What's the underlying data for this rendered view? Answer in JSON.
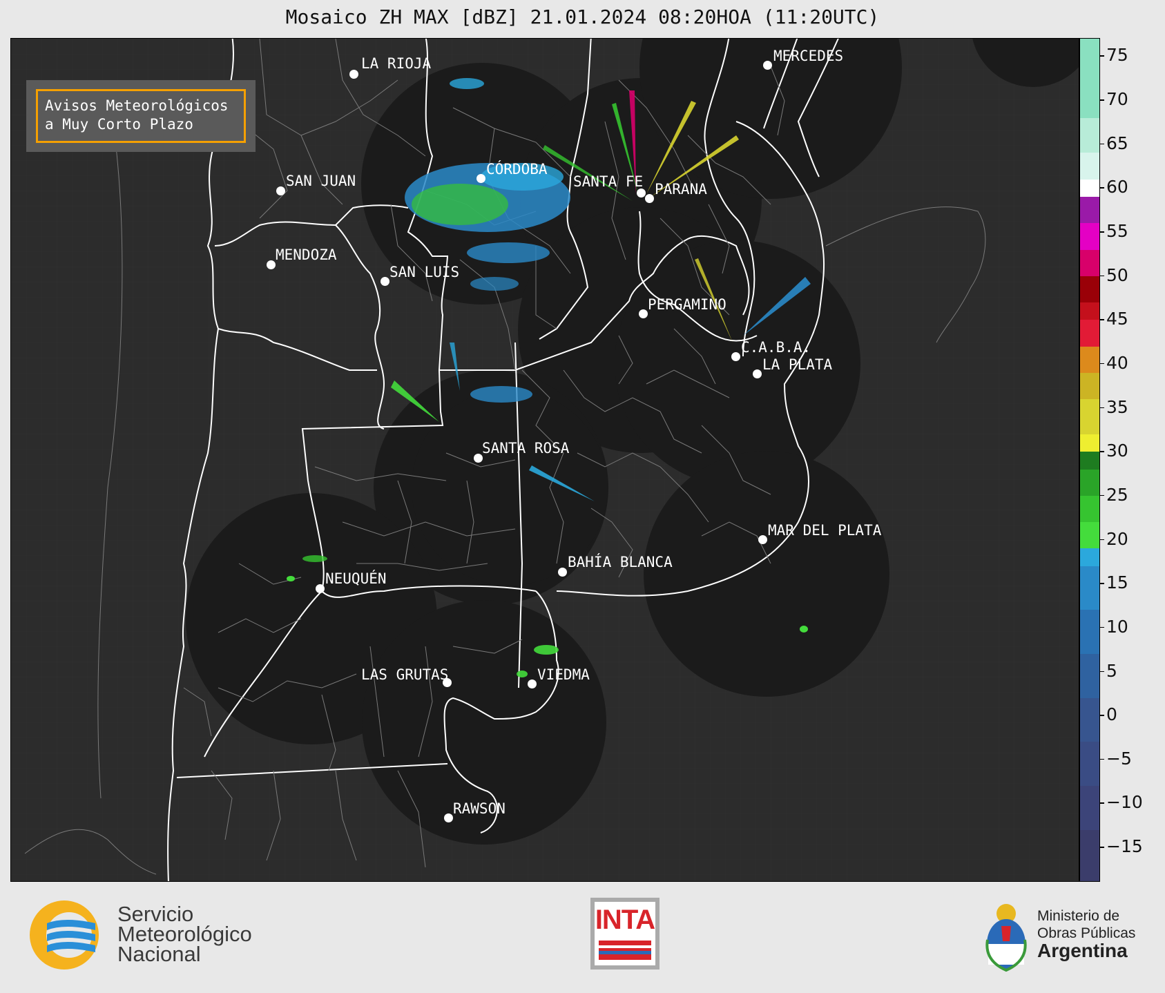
{
  "title": "Mosaico ZH MAX [dBZ] 21.01.2024 08:20HOA (11:20UTC)",
  "avisos": {
    "line1": "Avisos Meteorológicos",
    "line2": "a Muy Corto Plazo"
  },
  "colors": {
    "map_bg": "#2c2c2c",
    "radar_coverage": "#1b1b1b",
    "boundary": "#ffffff",
    "avisos_border": "#f5a000"
  },
  "cities": [
    {
      "name": "LA RIOJA"
    },
    {
      "name": "SAN JUAN"
    },
    {
      "name": "CÓRDOBA"
    },
    {
      "name": "SANTA FE"
    },
    {
      "name": "PARANA"
    },
    {
      "name": "MERCEDES"
    },
    {
      "name": "MENDOZA"
    },
    {
      "name": "SAN LUIS"
    },
    {
      "name": "PERGAMINO"
    },
    {
      "name": "C.A.B.A."
    },
    {
      "name": "LA PLATA"
    },
    {
      "name": "SANTA ROSA"
    },
    {
      "name": "MAR DEL PLATA"
    },
    {
      "name": "BAHÍA BLANCA"
    },
    {
      "name": "NEUQUÉN"
    },
    {
      "name": "LAS GRUTAS"
    },
    {
      "name": "VIEDMA"
    },
    {
      "name": "RAWSON"
    }
  ],
  "colorbar": {
    "unit": "dBZ",
    "min": -19,
    "max": 77,
    "ticks": [
      75,
      70,
      65,
      60,
      55,
      50,
      45,
      40,
      35,
      30,
      25,
      20,
      15,
      10,
      5,
      0,
      -5,
      -10,
      -15
    ],
    "tick_labels": [
      "75",
      "70",
      "65",
      "60",
      "55",
      "50",
      "45",
      "40",
      "35",
      "30",
      "25",
      "20",
      "15",
      "10",
      "5",
      "0",
      "−5",
      "−10",
      "−15"
    ],
    "segments": [
      {
        "from": -19,
        "to": -13,
        "color": "#3b3d6b"
      },
      {
        "from": -13,
        "to": -8,
        "color": "#3c4479"
      },
      {
        "from": -8,
        "to": -3,
        "color": "#3a4c84"
      },
      {
        "from": -3,
        "to": 2,
        "color": "#37558f"
      },
      {
        "from": 2,
        "to": 7,
        "color": "#2f62a0"
      },
      {
        "from": 7,
        "to": 12,
        "color": "#2a72b3"
      },
      {
        "from": 12,
        "to": 17,
        "color": "#2a8ac8"
      },
      {
        "from": 17,
        "to": 19,
        "color": "#2ba8dc"
      },
      {
        "from": 19,
        "to": 22,
        "color": "#44dc3c"
      },
      {
        "from": 22,
        "to": 25,
        "color": "#36c430"
      },
      {
        "from": 25,
        "to": 28,
        "color": "#2aa428"
      },
      {
        "from": 28,
        "to": 30,
        "color": "#1e7c20"
      },
      {
        "from": 30,
        "to": 32,
        "color": "#eeee30"
      },
      {
        "from": 32,
        "to": 36,
        "color": "#d8d430"
      },
      {
        "from": 36,
        "to": 39,
        "color": "#ccb424"
      },
      {
        "from": 39,
        "to": 42,
        "color": "#dc8a1c"
      },
      {
        "from": 42,
        "to": 45,
        "color": "#e21b36"
      },
      {
        "from": 45,
        "to": 47,
        "color": "#c4101c"
      },
      {
        "from": 47,
        "to": 50,
        "color": "#9a0008"
      },
      {
        "from": 50,
        "to": 53,
        "color": "#d8006a"
      },
      {
        "from": 53,
        "to": 56,
        "color": "#e400c4"
      },
      {
        "from": 56,
        "to": 59,
        "color": "#9a1aa8"
      },
      {
        "from": 59,
        "to": 61,
        "color": "#ffffff"
      },
      {
        "from": 61,
        "to": 64,
        "color": "#d8f4ec"
      },
      {
        "from": 64,
        "to": 68,
        "color": "#b8ecd8"
      },
      {
        "from": 68,
        "to": 77,
        "color": "#8ae0c0"
      }
    ]
  },
  "footer": {
    "smn": {
      "line1": "Servicio",
      "line2": "Meteorológico",
      "line3": "Nacional"
    },
    "inta": "INTA",
    "ministerio": {
      "line1": "Ministerio de",
      "line2": "Obras Públicas",
      "line3": "Argentina"
    }
  }
}
